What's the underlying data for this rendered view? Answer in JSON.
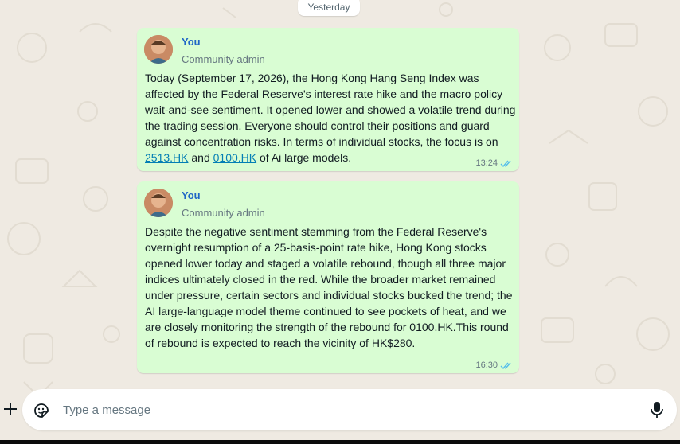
{
  "date_divider": "Yesterday",
  "messages": [
    {
      "sender": "You",
      "role": "Community admin",
      "text_before": "Today (September 17, 2026), the Hong Kong Hang Seng Index was affected by the Federal Reserve's interest rate hike and the macro policy wait-and-see sentiment. It opened lower and showed a volatile trend during the trading session. Everyone should control their positions and guard against concentration risks. In terms of individual stocks, the focus is on ",
      "link_1": "2513.HK",
      "text_mid": " and ",
      "link_2": "0100.HK",
      "text_after": " of Ai large models.",
      "time": "13:24"
    },
    {
      "sender": "You",
      "role": "Community admin",
      "text": "Despite the negative sentiment stemming from the Federal Reserve's overnight resumption of a 25-basis-point rate hike, Hong Kong stocks opened lower today and staged a volatile rebound, though all three major indices ultimately closed in the red. While the broader market remained under pressure, certain sectors and individual stocks bucked the trend; the AI large-language model theme continued to see pockets of heat, and we are closely monitoring the strength of the rebound for 0100.HK.This round of rebound is expected to reach the vicinity of HK$280.",
      "time": "16:30"
    }
  ],
  "composer": {
    "placeholder": "Type a message",
    "value": ""
  },
  "icons": {
    "attach": "plus-icon",
    "sticker": "sticker-icon",
    "voice": "microphone-icon",
    "read": "double-check-icon"
  },
  "colors": {
    "bubble": "#d9fdd3",
    "background": "#efeae2",
    "sender": "#1f66c6",
    "link": "#027eb5",
    "read_ticks": "#53bdeb"
  }
}
